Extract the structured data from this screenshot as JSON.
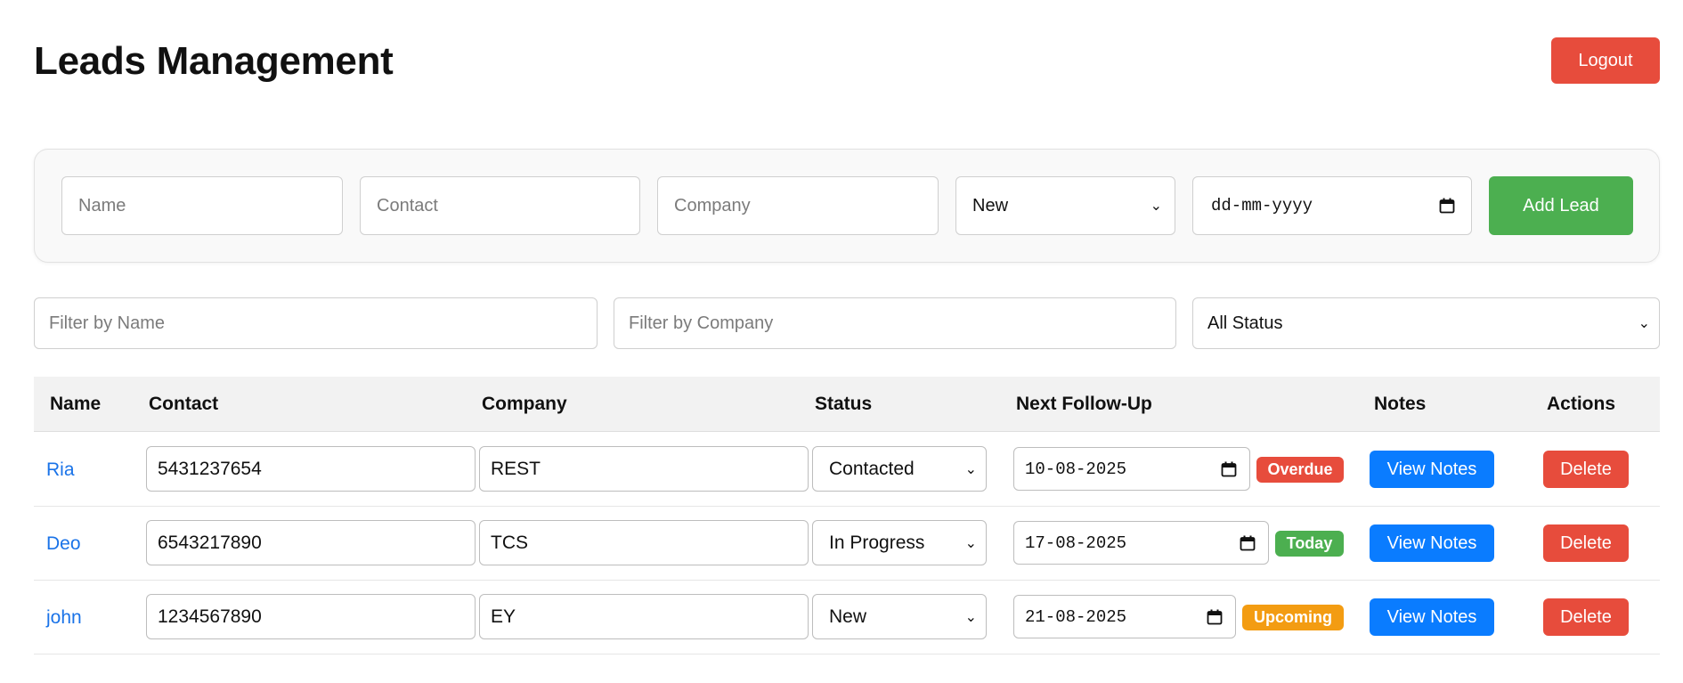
{
  "header": {
    "title": "Leads Management",
    "logout_label": "Logout"
  },
  "add_form": {
    "name_placeholder": "Name",
    "contact_placeholder": "Contact",
    "company_placeholder": "Company",
    "status_value": "New",
    "date_placeholder": "dd-mm-yyyy",
    "add_label": "Add Lead"
  },
  "filters": {
    "name_placeholder": "Filter by Name",
    "company_placeholder": "Filter by Company",
    "status_value": "All Status"
  },
  "table": {
    "columns": [
      "Name",
      "Contact",
      "Company",
      "Status",
      "Next Follow-Up",
      "Notes",
      "Actions"
    ],
    "rows": [
      {
        "name": "Ria",
        "contact": "5431237654",
        "company": "REST",
        "status": "Contacted",
        "follow_up": "10-08-2025",
        "badge": "Overdue",
        "badge_color": "#e74c3c",
        "notes_label": "View Notes",
        "delete_label": "Delete"
      },
      {
        "name": "Deo",
        "contact": "6543217890",
        "company": "TCS",
        "status": "In Progress",
        "follow_up": "17-08-2025",
        "badge": "Today",
        "badge_color": "#4caf50",
        "notes_label": "View Notes",
        "delete_label": "Delete"
      },
      {
        "name": "john",
        "contact": "1234567890",
        "company": "EY",
        "status": "New",
        "follow_up": "21-08-2025",
        "badge": "Upcoming",
        "badge_color": "#f39c12",
        "notes_label": "View Notes",
        "delete_label": "Delete"
      }
    ]
  },
  "colors": {
    "danger": "#e74c3c",
    "success": "#4caf50",
    "primary": "#0a7cff",
    "warning": "#f39c12",
    "link": "#1a73e8"
  }
}
